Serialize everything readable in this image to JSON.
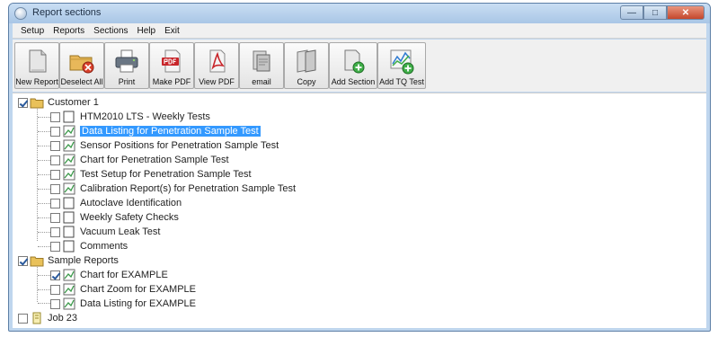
{
  "window": {
    "title": "Report sections"
  },
  "menu": [
    "Setup",
    "Reports",
    "Sections",
    "Help",
    "Exit"
  ],
  "toolbar": [
    {
      "label": "New Report",
      "icon": "new-report-icon"
    },
    {
      "label": "Deselect All",
      "icon": "deselect-all-icon"
    },
    {
      "label": "Print",
      "icon": "printer-icon"
    },
    {
      "label": "Make PDF",
      "icon": "make-pdf-icon"
    },
    {
      "label": "View PDF",
      "icon": "view-pdf-icon"
    },
    {
      "label": "email",
      "icon": "email-icon"
    },
    {
      "label": "Copy",
      "icon": "copy-icon"
    },
    {
      "label": "Add Section",
      "icon": "add-section-icon"
    },
    {
      "label": "Add TQ Test",
      "icon": "add-tq-test-icon"
    }
  ],
  "tree": {
    "groups": [
      {
        "label": "Customer 1",
        "checked": true,
        "icon": "folder-icon",
        "items": [
          {
            "label": "HTM2010 LTS - Weekly Tests",
            "icon": "document-icon",
            "checked": false
          },
          {
            "label": "Data Listing for Penetration Sample Test",
            "icon": "chart-doc-icon",
            "checked": false,
            "selected": true
          },
          {
            "label": "Sensor Positions for Penetration Sample Test",
            "icon": "chart-doc-icon",
            "checked": false
          },
          {
            "label": "Chart for Penetration Sample Test",
            "icon": "chart-doc-icon",
            "checked": false
          },
          {
            "label": "Test Setup for Penetration Sample Test",
            "icon": "chart-doc-icon",
            "checked": false
          },
          {
            "label": "Calibration Report(s) for Penetration Sample Test",
            "icon": "chart-doc-icon",
            "checked": false
          },
          {
            "label": "Autoclave Identification",
            "icon": "document-icon",
            "checked": false
          },
          {
            "label": "Weekly Safety Checks",
            "icon": "document-icon",
            "checked": false
          },
          {
            "label": "Vacuum Leak Test",
            "icon": "document-icon",
            "checked": false
          },
          {
            "label": "Comments",
            "icon": "document-icon",
            "checked": false
          }
        ]
      },
      {
        "label": "Sample Reports",
        "checked": true,
        "icon": "folder-icon",
        "items": [
          {
            "label": "Chart for EXAMPLE",
            "icon": "chart-doc-icon",
            "checked": true
          },
          {
            "label": "Chart Zoom for EXAMPLE",
            "icon": "chart-doc-icon",
            "checked": false
          },
          {
            "label": "Data Listing for EXAMPLE",
            "icon": "chart-doc-icon",
            "checked": false
          }
        ]
      },
      {
        "label": "Job 23",
        "checked": false,
        "icon": "note-icon",
        "items": []
      }
    ]
  }
}
